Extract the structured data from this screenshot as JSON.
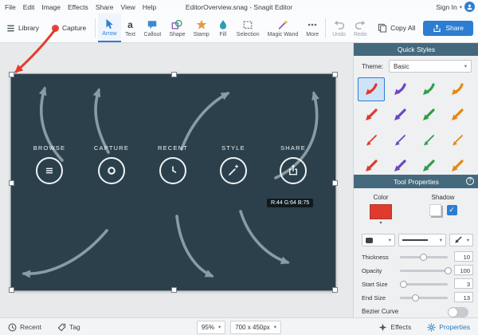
{
  "window": {
    "title": "EditorOverview.snag - Snagit Editor",
    "sign_in": "Sign In"
  },
  "menu_bar": {
    "items": [
      "File",
      "Edit",
      "Image",
      "Effects",
      "Share",
      "View",
      "Help"
    ]
  },
  "toolbar": {
    "library": "Library",
    "capture": "Capture",
    "tools": [
      {
        "label": "Arrow",
        "selected": true
      },
      {
        "label": "Text"
      },
      {
        "label": "Callout"
      },
      {
        "label": "Shape"
      },
      {
        "label": "Stamp"
      },
      {
        "label": "Fill"
      },
      {
        "label": "Selection"
      },
      {
        "label": "Magic Wand"
      },
      {
        "label": "More"
      }
    ],
    "undo": "Undo",
    "redo": "Redo",
    "copy_all": "Copy All",
    "share": "Share"
  },
  "canvas": {
    "bg_color": "#2c404b",
    "features": [
      {
        "label": "BROWSE",
        "icon": "menu-lines"
      },
      {
        "label": "CAPTURE",
        "icon": "ring"
      },
      {
        "label": "RECENT",
        "icon": "clock"
      },
      {
        "label": "STYLE",
        "icon": "magic-wand"
      },
      {
        "label": "SHARE",
        "icon": "share-box"
      }
    ],
    "tooltip": "R:44 G:64 B:75"
  },
  "quick_styles": {
    "header": "Quick Styles",
    "theme_label": "Theme:",
    "theme_value": "Basic",
    "grid": [
      {
        "color": "#dc3a2e",
        "style": "curved",
        "selected": true
      },
      {
        "color": "#6b46c1",
        "style": "curved"
      },
      {
        "color": "#2f9e44",
        "style": "curved"
      },
      {
        "color": "#e8860d",
        "style": "curved"
      },
      {
        "color": "#dc3a2e",
        "style": "straight"
      },
      {
        "color": "#6b46c1",
        "style": "straight"
      },
      {
        "color": "#2f9e44",
        "style": "straight"
      },
      {
        "color": "#e8860d",
        "style": "straight"
      },
      {
        "color": "#dc3a2e",
        "style": "thin"
      },
      {
        "color": "#6b46c1",
        "style": "thin"
      },
      {
        "color": "#2f9e44",
        "style": "thin"
      },
      {
        "color": "#e8860d",
        "style": "thin"
      },
      {
        "color": "#dc3a2e",
        "style": "straight"
      },
      {
        "color": "#6b46c1",
        "style": "straight"
      },
      {
        "color": "#2f9e44",
        "style": "straight"
      },
      {
        "color": "#e8860d",
        "style": "straight"
      }
    ]
  },
  "tool_properties": {
    "header": "Tool Properties",
    "help": "?",
    "color_label": "Color",
    "color_value": "#e0392e",
    "shadow_label": "Shadow",
    "shadow_checked": true,
    "sliders": [
      {
        "label": "Thickness",
        "value": "10",
        "pct": 48
      },
      {
        "label": "Opacity",
        "value": "100",
        "pct": 100
      },
      {
        "label": "Start Size",
        "value": "3",
        "pct": 7
      },
      {
        "label": "End Size",
        "value": "13",
        "pct": 32
      }
    ],
    "bezier_label": "Bezier Curve",
    "bezier_on": false
  },
  "status_bar": {
    "recent": "Recent",
    "tag": "Tag",
    "zoom": "95%",
    "size": "700 x 450px",
    "effects": "Effects",
    "properties": "Properties"
  },
  "colors": {
    "accent": "#2d7dd2",
    "panel_header": "#44697d",
    "annotation_red": "#e23b2e"
  }
}
